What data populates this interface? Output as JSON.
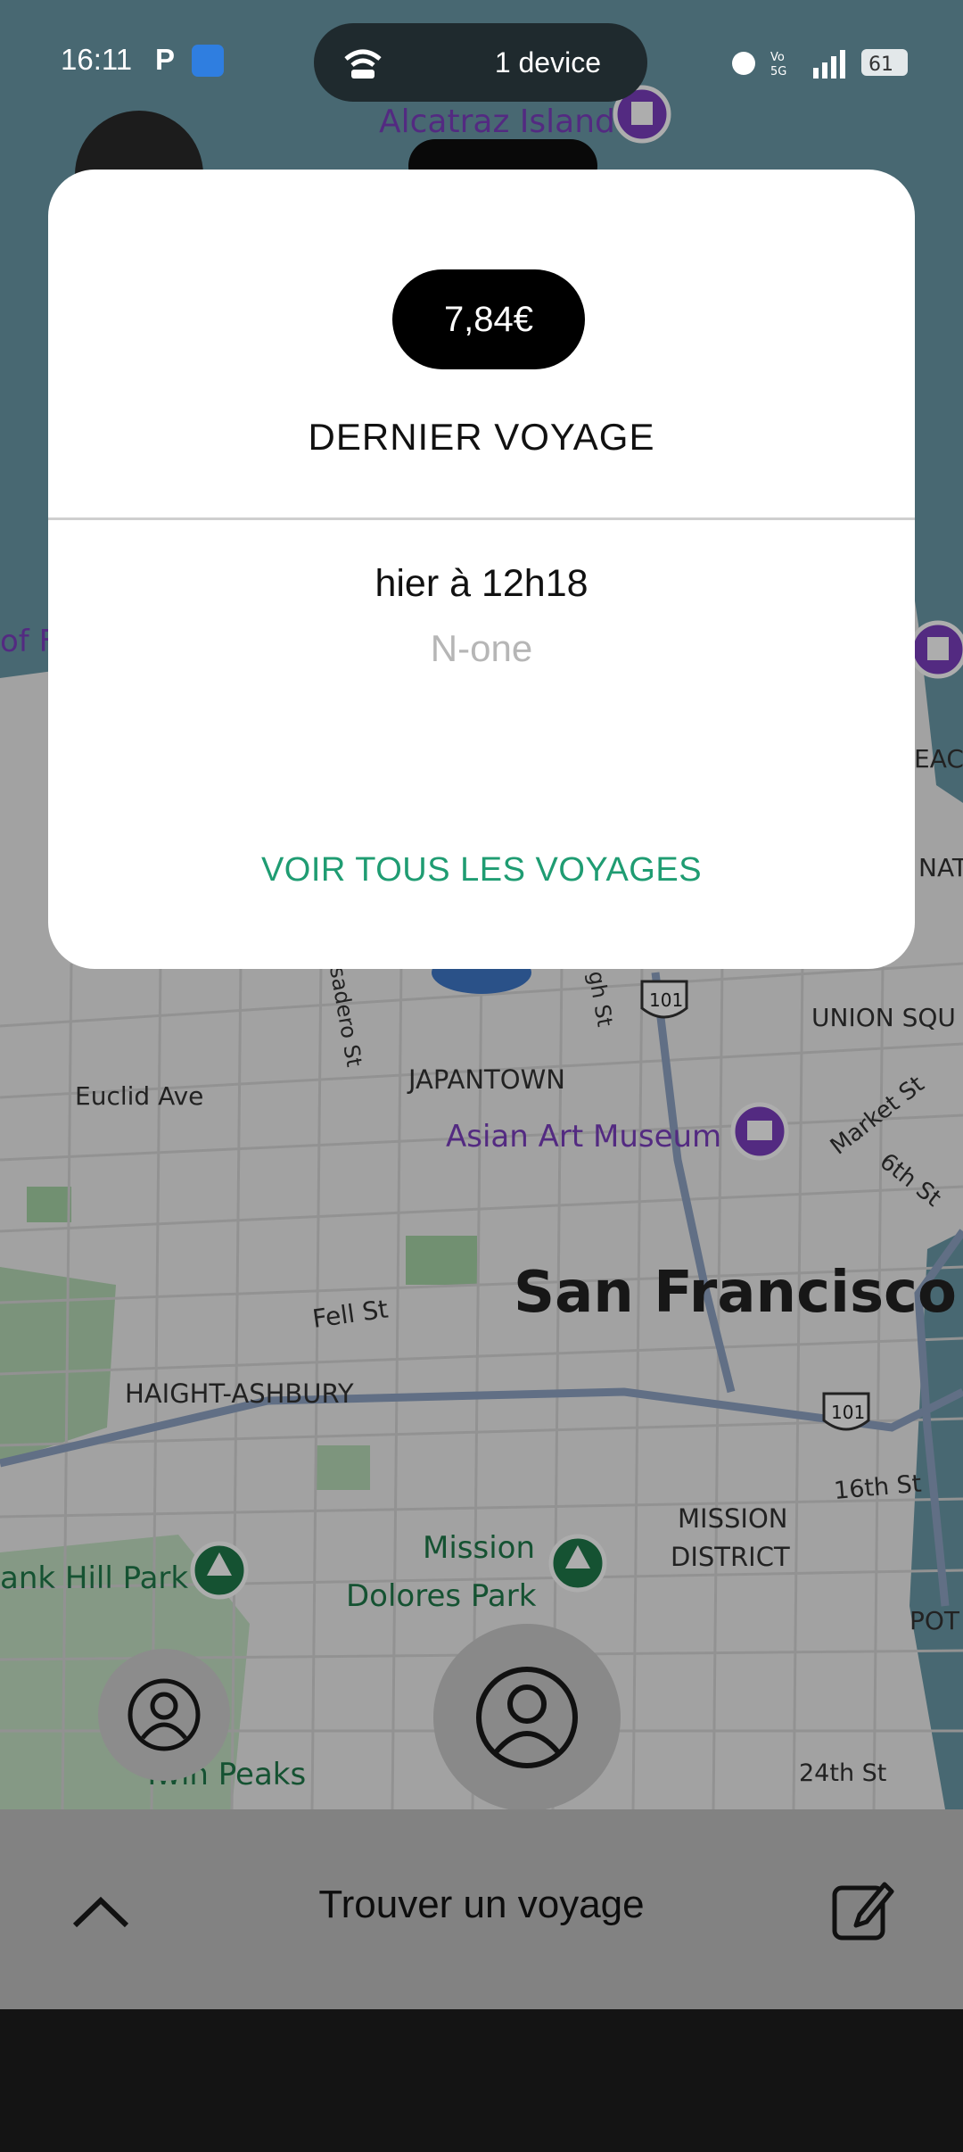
{
  "status_bar": {
    "time": "16:11",
    "p_icon": "P",
    "hotspot_label": "1 device",
    "battery": "61"
  },
  "map": {
    "labels": {
      "alcatraz": "Alcatraz Island",
      "euclid": "Euclid Ave",
      "japantown": "JAPANTOWN",
      "asian_art": "Asian Art Museum",
      "san_francisco": "San Francisco",
      "fell": "Fell St",
      "haight": "HAIGHT-ASHBURY",
      "mission_district_1": "MISSION",
      "mission_district_2": "DISTRICT",
      "mission_dolores_1": "Mission",
      "mission_dolores_2": "Dolores Park",
      "tank_hill": "ank Hill Park",
      "twin_peaks": "Twin Peaks",
      "union_sq": "UNION SQU",
      "market_st": "Market St",
      "sixth_st": "6th St",
      "sixteenth_st": "16th St",
      "twentyfourth_st": "24th St",
      "divisadero": "sadero St",
      "gough": "gh St",
      "hwy101_a": "101",
      "hwy101_b": "101",
      "pot": "POT",
      "beac": "EAC",
      "nat": "NAT",
      "of_f": "of F"
    }
  },
  "modal": {
    "price": "7,84€",
    "title": "DERNIER VOYAGE",
    "trip_time": "hier à 12h18",
    "company": "N-one",
    "view_all": "VOIR TOUS LES VOYAGES"
  },
  "bottom_bar": {
    "find_label": "Trouver un voyage"
  },
  "colors": {
    "accent": "#1f9c72",
    "price_pill": "#000000",
    "map_water": "#6b9aa8",
    "poi_purple": "#7b3fbf",
    "park_green": "#1f7a4a"
  },
  "icons": [
    "hotspot-icon",
    "android-icon",
    "alarm-icon",
    "signal-icon",
    "battery-icon",
    "user-icon",
    "chevron-up-icon",
    "edit-icon"
  ]
}
